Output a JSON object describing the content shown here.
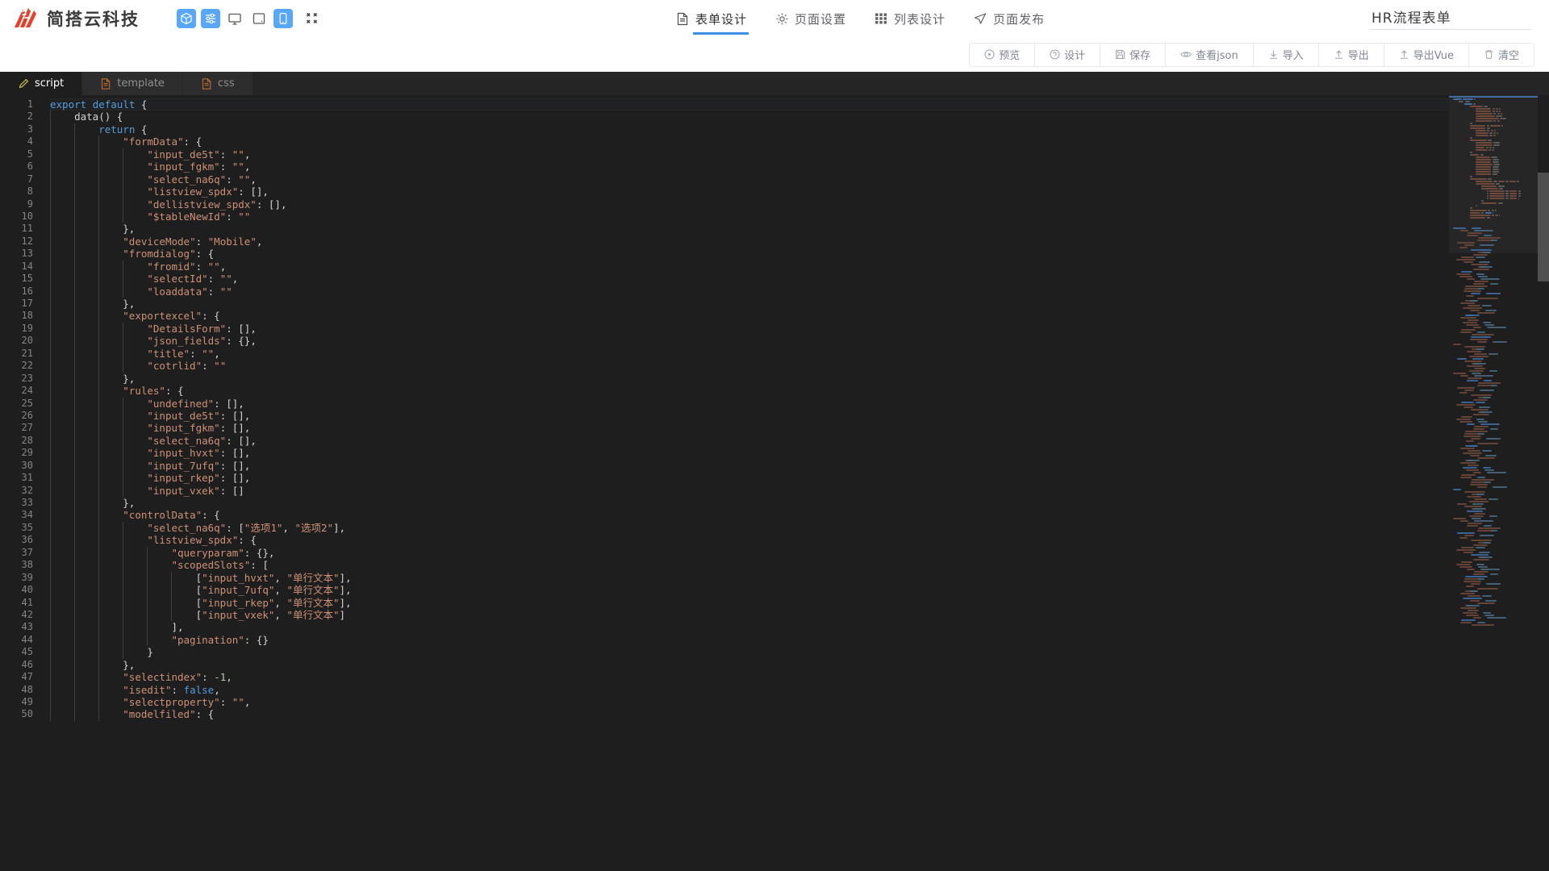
{
  "header": {
    "brand_name": "简搭云科技",
    "logo_icon": "flame-logo-icon",
    "device_modes": [
      {
        "icon": "cube-icon",
        "name": "component-mode",
        "active": true
      },
      {
        "icon": "sliders-icon",
        "name": "settings-mode",
        "active": true
      },
      {
        "icon": "monitor-icon",
        "name": "desktop-mode",
        "active": false
      },
      {
        "icon": "tablet-icon",
        "name": "tablet-mode",
        "active": false
      },
      {
        "icon": "phone-icon",
        "name": "mobile-mode",
        "active": true
      }
    ],
    "fullscreen_icon": "collapse-fullscreen-icon",
    "nav": [
      {
        "label": "表单设计",
        "icon": "document-icon",
        "active": true
      },
      {
        "label": "页面设置",
        "icon": "gear-icon",
        "active": false
      },
      {
        "label": "列表设计",
        "icon": "grid-icon",
        "active": false
      },
      {
        "label": "页面发布",
        "icon": "send-icon",
        "active": false
      }
    ],
    "title_value": "HR流程表单",
    "title_placeholder": "请输入表单名称"
  },
  "toolbar": {
    "buttons": [
      {
        "label": "预览",
        "icon": "play-circle-icon"
      },
      {
        "label": "设计",
        "icon": "design-circle-icon"
      },
      {
        "label": "保存",
        "icon": "save-icon"
      },
      {
        "label": "查看json",
        "icon": "eye-icon"
      },
      {
        "label": "导入",
        "icon": "download-icon"
      },
      {
        "label": "导出",
        "icon": "upload-icon"
      },
      {
        "label": "导出Vue",
        "icon": "upload-icon"
      },
      {
        "label": "清空",
        "icon": "trash-icon"
      }
    ]
  },
  "editor_tabs": [
    {
      "label": "script",
      "icon": "pencil-icon",
      "active": true
    },
    {
      "label": "template",
      "icon": "file-icon",
      "active": false
    },
    {
      "label": "css",
      "icon": "file-icon",
      "active": false
    }
  ],
  "editor": {
    "language": "javascript",
    "first_line": 1,
    "total_visible_lines": 50,
    "cursor_line": 1,
    "lines": [
      {
        "n": 1,
        "indent": 0,
        "tokens": [
          {
            "t": "export ",
            "c": "k"
          },
          {
            "t": "default ",
            "c": "k"
          },
          {
            "t": "{",
            "c": "p"
          }
        ]
      },
      {
        "n": 2,
        "indent": 1,
        "tokens": [
          {
            "t": "data",
            "c": "p"
          },
          {
            "t": "() {",
            "c": "p"
          }
        ]
      },
      {
        "n": 3,
        "indent": 2,
        "tokens": [
          {
            "t": "return",
            "c": "k"
          },
          {
            "t": " {",
            "c": "p"
          }
        ]
      },
      {
        "n": 4,
        "indent": 3,
        "tokens": [
          {
            "t": "\"formData\"",
            "c": "s"
          },
          {
            "t": ": {",
            "c": "p"
          }
        ]
      },
      {
        "n": 5,
        "indent": 4,
        "tokens": [
          {
            "t": "\"input_de5t\"",
            "c": "s"
          },
          {
            "t": ": ",
            "c": "p"
          },
          {
            "t": "\"\"",
            "c": "s"
          },
          {
            "t": ",",
            "c": "p"
          }
        ]
      },
      {
        "n": 6,
        "indent": 4,
        "tokens": [
          {
            "t": "\"input_fgkm\"",
            "c": "s"
          },
          {
            "t": ": ",
            "c": "p"
          },
          {
            "t": "\"\"",
            "c": "s"
          },
          {
            "t": ",",
            "c": "p"
          }
        ]
      },
      {
        "n": 7,
        "indent": 4,
        "tokens": [
          {
            "t": "\"select_na6q\"",
            "c": "s"
          },
          {
            "t": ": ",
            "c": "p"
          },
          {
            "t": "\"\"",
            "c": "s"
          },
          {
            "t": ",",
            "c": "p"
          }
        ]
      },
      {
        "n": 8,
        "indent": 4,
        "tokens": [
          {
            "t": "\"listview_spdx\"",
            "c": "s"
          },
          {
            "t": ": [],",
            "c": "p"
          }
        ]
      },
      {
        "n": 9,
        "indent": 4,
        "tokens": [
          {
            "t": "\"dellistview_spdx\"",
            "c": "s"
          },
          {
            "t": ": [],",
            "c": "p"
          }
        ]
      },
      {
        "n": 10,
        "indent": 4,
        "tokens": [
          {
            "t": "\"$tableNewId\"",
            "c": "s"
          },
          {
            "t": ": ",
            "c": "p"
          },
          {
            "t": "\"\"",
            "c": "s"
          }
        ]
      },
      {
        "n": 11,
        "indent": 3,
        "tokens": [
          {
            "t": "},",
            "c": "p"
          }
        ]
      },
      {
        "n": 12,
        "indent": 3,
        "tokens": [
          {
            "t": "\"deviceMode\"",
            "c": "s"
          },
          {
            "t": ": ",
            "c": "p"
          },
          {
            "t": "\"Mobile\"",
            "c": "s"
          },
          {
            "t": ",",
            "c": "p"
          }
        ]
      },
      {
        "n": 13,
        "indent": 3,
        "tokens": [
          {
            "t": "\"fromdialog\"",
            "c": "s"
          },
          {
            "t": ": {",
            "c": "p"
          }
        ]
      },
      {
        "n": 14,
        "indent": 4,
        "tokens": [
          {
            "t": "\"fromid\"",
            "c": "s"
          },
          {
            "t": ": ",
            "c": "p"
          },
          {
            "t": "\"\"",
            "c": "s"
          },
          {
            "t": ",",
            "c": "p"
          }
        ]
      },
      {
        "n": 15,
        "indent": 4,
        "tokens": [
          {
            "t": "\"selectId\"",
            "c": "s"
          },
          {
            "t": ": ",
            "c": "p"
          },
          {
            "t": "\"\"",
            "c": "s"
          },
          {
            "t": ",",
            "c": "p"
          }
        ]
      },
      {
        "n": 16,
        "indent": 4,
        "tokens": [
          {
            "t": "\"loaddata\"",
            "c": "s"
          },
          {
            "t": ": ",
            "c": "p"
          },
          {
            "t": "\"\"",
            "c": "s"
          }
        ]
      },
      {
        "n": 17,
        "indent": 3,
        "tokens": [
          {
            "t": "},",
            "c": "p"
          }
        ]
      },
      {
        "n": 18,
        "indent": 3,
        "tokens": [
          {
            "t": "\"exportexcel\"",
            "c": "s"
          },
          {
            "t": ": {",
            "c": "p"
          }
        ]
      },
      {
        "n": 19,
        "indent": 4,
        "tokens": [
          {
            "t": "\"DetailsForm\"",
            "c": "s"
          },
          {
            "t": ": [],",
            "c": "p"
          }
        ]
      },
      {
        "n": 20,
        "indent": 4,
        "tokens": [
          {
            "t": "\"json_fields\"",
            "c": "s"
          },
          {
            "t": ": {},",
            "c": "p"
          }
        ]
      },
      {
        "n": 21,
        "indent": 4,
        "tokens": [
          {
            "t": "\"title\"",
            "c": "s"
          },
          {
            "t": ": ",
            "c": "p"
          },
          {
            "t": "\"\"",
            "c": "s"
          },
          {
            "t": ",",
            "c": "p"
          }
        ]
      },
      {
        "n": 22,
        "indent": 4,
        "tokens": [
          {
            "t": "\"cotrlid\"",
            "c": "s"
          },
          {
            "t": ": ",
            "c": "p"
          },
          {
            "t": "\"\"",
            "c": "s"
          }
        ]
      },
      {
        "n": 23,
        "indent": 3,
        "tokens": [
          {
            "t": "},",
            "c": "p"
          }
        ]
      },
      {
        "n": 24,
        "indent": 3,
        "tokens": [
          {
            "t": "\"rules\"",
            "c": "s"
          },
          {
            "t": ": {",
            "c": "p"
          }
        ]
      },
      {
        "n": 25,
        "indent": 4,
        "tokens": [
          {
            "t": "\"undefined\"",
            "c": "s"
          },
          {
            "t": ": [],",
            "c": "p"
          }
        ]
      },
      {
        "n": 26,
        "indent": 4,
        "tokens": [
          {
            "t": "\"input_de5t\"",
            "c": "s"
          },
          {
            "t": ": [],",
            "c": "p"
          }
        ]
      },
      {
        "n": 27,
        "indent": 4,
        "tokens": [
          {
            "t": "\"input_fgkm\"",
            "c": "s"
          },
          {
            "t": ": [],",
            "c": "p"
          }
        ]
      },
      {
        "n": 28,
        "indent": 4,
        "tokens": [
          {
            "t": "\"select_na6q\"",
            "c": "s"
          },
          {
            "t": ": [],",
            "c": "p"
          }
        ]
      },
      {
        "n": 29,
        "indent": 4,
        "tokens": [
          {
            "t": "\"input_hvxt\"",
            "c": "s"
          },
          {
            "t": ": [],",
            "c": "p"
          }
        ]
      },
      {
        "n": 30,
        "indent": 4,
        "tokens": [
          {
            "t": "\"input_7ufq\"",
            "c": "s"
          },
          {
            "t": ": [],",
            "c": "p"
          }
        ]
      },
      {
        "n": 31,
        "indent": 4,
        "tokens": [
          {
            "t": "\"input_rkep\"",
            "c": "s"
          },
          {
            "t": ": [],",
            "c": "p"
          }
        ]
      },
      {
        "n": 32,
        "indent": 4,
        "tokens": [
          {
            "t": "\"input_vxek\"",
            "c": "s"
          },
          {
            "t": ": []",
            "c": "p"
          }
        ]
      },
      {
        "n": 33,
        "indent": 3,
        "tokens": [
          {
            "t": "},",
            "c": "p"
          }
        ]
      },
      {
        "n": 34,
        "indent": 3,
        "tokens": [
          {
            "t": "\"controlData\"",
            "c": "s"
          },
          {
            "t": ": {",
            "c": "p"
          }
        ]
      },
      {
        "n": 35,
        "indent": 4,
        "tokens": [
          {
            "t": "\"select_na6q\"",
            "c": "s"
          },
          {
            "t": ": [",
            "c": "p"
          },
          {
            "t": "\"选项1\"",
            "c": "s"
          },
          {
            "t": ", ",
            "c": "p"
          },
          {
            "t": "\"选项2\"",
            "c": "s"
          },
          {
            "t": "],",
            "c": "p"
          }
        ]
      },
      {
        "n": 36,
        "indent": 4,
        "tokens": [
          {
            "t": "\"listview_spdx\"",
            "c": "s"
          },
          {
            "t": ": {",
            "c": "p"
          }
        ]
      },
      {
        "n": 37,
        "indent": 5,
        "tokens": [
          {
            "t": "\"queryparam\"",
            "c": "s"
          },
          {
            "t": ": {},",
            "c": "p"
          }
        ]
      },
      {
        "n": 38,
        "indent": 5,
        "tokens": [
          {
            "t": "\"scopedSlots\"",
            "c": "s"
          },
          {
            "t": ": [",
            "c": "p"
          }
        ]
      },
      {
        "n": 39,
        "indent": 6,
        "tokens": [
          {
            "t": "[",
            "c": "p"
          },
          {
            "t": "\"input_hvxt\"",
            "c": "s"
          },
          {
            "t": ", ",
            "c": "p"
          },
          {
            "t": "\"单行文本\"",
            "c": "s"
          },
          {
            "t": "],",
            "c": "p"
          }
        ]
      },
      {
        "n": 40,
        "indent": 6,
        "tokens": [
          {
            "t": "[",
            "c": "p"
          },
          {
            "t": "\"input_7ufq\"",
            "c": "s"
          },
          {
            "t": ", ",
            "c": "p"
          },
          {
            "t": "\"单行文本\"",
            "c": "s"
          },
          {
            "t": "],",
            "c": "p"
          }
        ]
      },
      {
        "n": 41,
        "indent": 6,
        "tokens": [
          {
            "t": "[",
            "c": "p"
          },
          {
            "t": "\"input_rkep\"",
            "c": "s"
          },
          {
            "t": ", ",
            "c": "p"
          },
          {
            "t": "\"单行文本\"",
            "c": "s"
          },
          {
            "t": "],",
            "c": "p"
          }
        ]
      },
      {
        "n": 42,
        "indent": 6,
        "tokens": [
          {
            "t": "[",
            "c": "p"
          },
          {
            "t": "\"input_vxek\"",
            "c": "s"
          },
          {
            "t": ", ",
            "c": "p"
          },
          {
            "t": "\"单行文本\"",
            "c": "s"
          },
          {
            "t": "]",
            "c": "p"
          }
        ]
      },
      {
        "n": 43,
        "indent": 5,
        "tokens": [
          {
            "t": "],",
            "c": "p"
          }
        ]
      },
      {
        "n": 44,
        "indent": 5,
        "tokens": [
          {
            "t": "\"pagination\"",
            "c": "s"
          },
          {
            "t": ": {}",
            "c": "p"
          }
        ]
      },
      {
        "n": 45,
        "indent": 4,
        "tokens": [
          {
            "t": "}",
            "c": "p"
          }
        ]
      },
      {
        "n": 46,
        "indent": 3,
        "tokens": [
          {
            "t": "},",
            "c": "p"
          }
        ]
      },
      {
        "n": 47,
        "indent": 3,
        "tokens": [
          {
            "t": "\"selectindex\"",
            "c": "s"
          },
          {
            "t": ": ",
            "c": "p"
          },
          {
            "t": "-1",
            "c": "n"
          },
          {
            "t": ",",
            "c": "p"
          }
        ]
      },
      {
        "n": 48,
        "indent": 3,
        "tokens": [
          {
            "t": "\"isedit\"",
            "c": "s"
          },
          {
            "t": ": ",
            "c": "p"
          },
          {
            "t": "false",
            "c": "k"
          },
          {
            "t": ",",
            "c": "p"
          }
        ]
      },
      {
        "n": 49,
        "indent": 3,
        "tokens": [
          {
            "t": "\"selectproperty\"",
            "c": "s"
          },
          {
            "t": ": ",
            "c": "p"
          },
          {
            "t": "\"\"",
            "c": "s"
          },
          {
            "t": ",",
            "c": "p"
          }
        ]
      },
      {
        "n": 50,
        "indent": 3,
        "tokens": [
          {
            "t": "\"modelfiled\"",
            "c": "s"
          },
          {
            "t": ": {",
            "c": "p"
          }
        ]
      }
    ]
  },
  "colors": {
    "accent": "#58a7fb",
    "nav_active_underline": "#3a8ee6",
    "editor_bg": "#1e1e1e",
    "tab_inactive_bg": "#2d2d2d",
    "string": "#ce9178",
    "keyword": "#569cd6",
    "number": "#b5cea8",
    "linenumber": "#858585"
  }
}
